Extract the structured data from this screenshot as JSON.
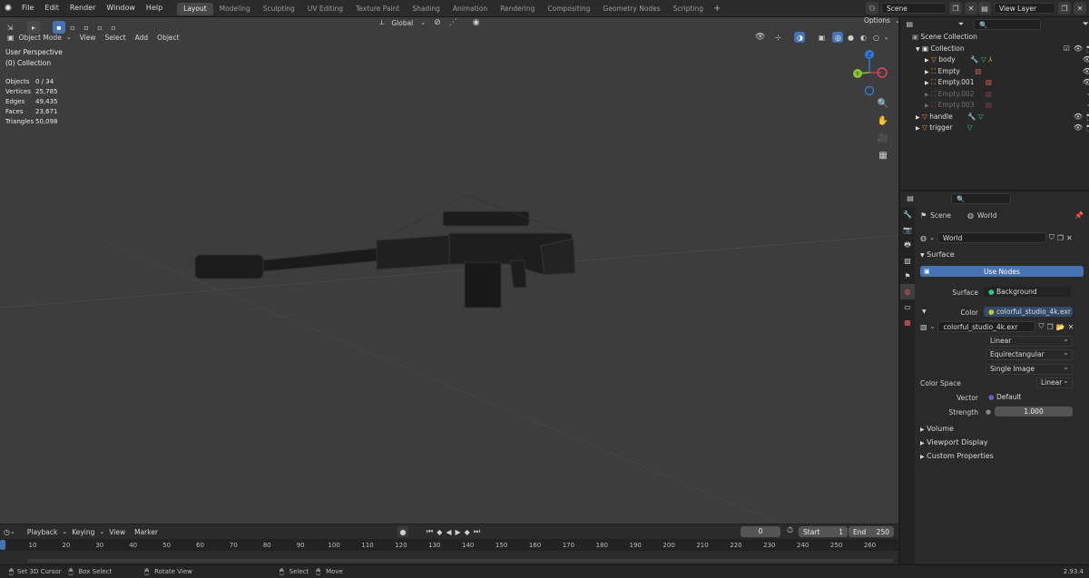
{
  "menu": [
    "File",
    "Edit",
    "Render",
    "Window",
    "Help"
  ],
  "workspaces": [
    "Layout",
    "Modeling",
    "Sculpting",
    "UV Editing",
    "Texture Paint",
    "Shading",
    "Animation",
    "Rendering",
    "Compositing",
    "Geometry Nodes",
    "Scripting"
  ],
  "active_workspace": "Layout",
  "scene": "Scene",
  "view_layer": "View Layer",
  "viewport": {
    "mode": "Object Mode",
    "menus": [
      "View",
      "Select",
      "Add",
      "Object"
    ],
    "transform_orientation": "Global",
    "options": "Options",
    "overlay_title": "User Perspective",
    "overlay_collection": "(0) Collection",
    "stats": [
      {
        "label": "Objects",
        "value": "0 / 34"
      },
      {
        "label": "Vertices",
        "value": "25,785"
      },
      {
        "label": "Edges",
        "value": "49,435"
      },
      {
        "label": "Faces",
        "value": "23,671"
      },
      {
        "label": "Triangles",
        "value": "50,098"
      }
    ],
    "gizmo": {
      "z": "Z",
      "y": "Y"
    }
  },
  "outliner": {
    "root": "Scene Collection",
    "items": [
      {
        "label": "Collection",
        "depth": 0,
        "dim": false
      },
      {
        "label": "body",
        "depth": 1,
        "dim": false
      },
      {
        "label": "Empty",
        "depth": 1,
        "dim": false
      },
      {
        "label": "Empty.001",
        "depth": 1,
        "dim": false
      },
      {
        "label": "Empty.002",
        "depth": 1,
        "dim": true
      },
      {
        "label": "Empty.003",
        "depth": 1,
        "dim": true
      },
      {
        "label": "handle",
        "depth": 0,
        "dim": false
      },
      {
        "label": "trigger",
        "depth": 0,
        "dim": false
      }
    ]
  },
  "properties": {
    "breadcrumb_scene": "Scene",
    "breadcrumb_world": "World",
    "world_name": "World",
    "surface_panel": "Surface",
    "use_nodes": "Use Nodes",
    "surface_label": "Surface",
    "surface_value": "Background",
    "color_label": "Color",
    "color_value": "colorful_studio_4k.exr",
    "image_name": "colorful_studio_4k.exr",
    "interpolation": "Linear",
    "projection": "Equirectangular",
    "source": "Single Image",
    "color_space_label": "Color Space",
    "color_space": "Linear",
    "vector_label": "Vector",
    "vector_value": "Default",
    "strength_label": "Strength",
    "strength_value": "1.000",
    "panels": [
      "Volume",
      "Viewport Display",
      "Custom Properties"
    ]
  },
  "timeline": {
    "menus": [
      "Playback",
      "Keying",
      "View",
      "Marker"
    ],
    "current_frame": "0",
    "start_label": "Start",
    "start": "1",
    "end_label": "End",
    "end": "250",
    "ticks": [
      "10",
      "20",
      "30",
      "40",
      "50",
      "60",
      "70",
      "80",
      "90",
      "100",
      "110",
      "120",
      "130",
      "140",
      "150",
      "160",
      "170",
      "180",
      "190",
      "200",
      "210",
      "220",
      "230",
      "240",
      "250",
      "260"
    ]
  },
  "statusbar": {
    "hints": [
      "Set 3D Cursor",
      "Box Select",
      "Rotate View",
      "Select",
      "Move"
    ],
    "version": "2.93.4"
  },
  "colors": {
    "accent": "#4772b3",
    "viewport_bg": "#3d3d3d",
    "panel_bg": "#2a2a2a",
    "gizmo_z": "#2f7bd9",
    "gizmo_y": "#8ac33a",
    "gizmo_x": "#e04b5a"
  }
}
